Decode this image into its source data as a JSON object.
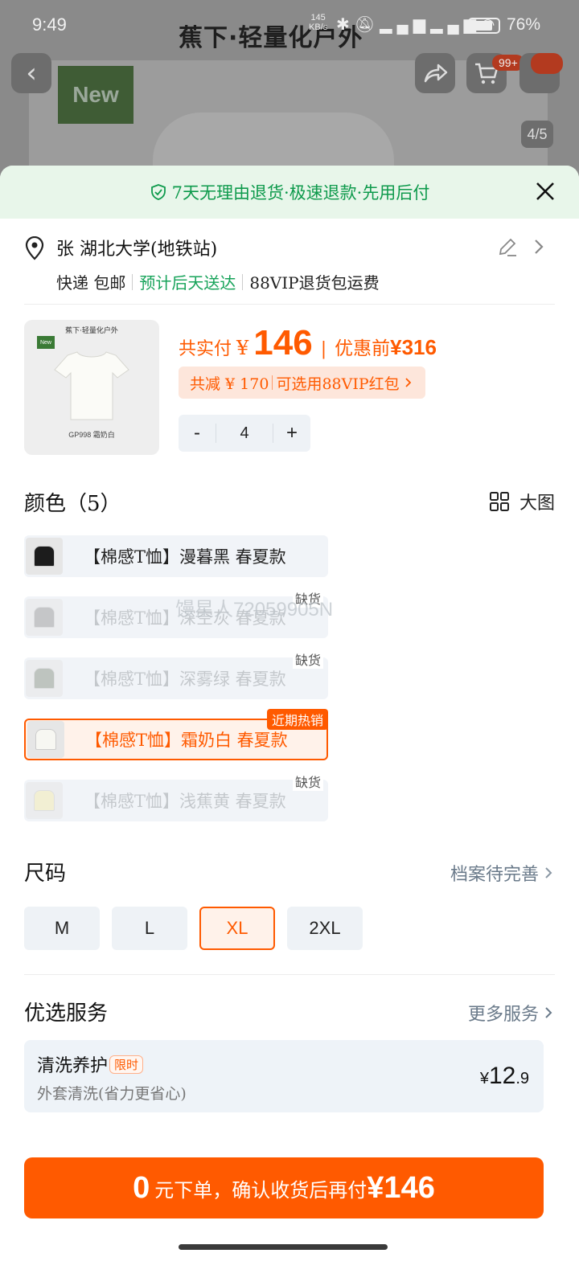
{
  "status_bar": {
    "time": "9:49",
    "speed_value": "145",
    "speed_unit": "KB/s",
    "battery": "76%"
  },
  "background": {
    "brand": "蕉下·轻量化户外",
    "new_tag": "New",
    "cart_badge": "99+",
    "image_counter": "4/5"
  },
  "banner": {
    "text": "7天无理由退货·极速退款·先用后付"
  },
  "address": {
    "line": "张 湖北大学(地铁站)",
    "shipping": "快递 包邮",
    "estimate": "预计后天送达",
    "vip_return": "88VIP退货包运费"
  },
  "product": {
    "thumb_brand": "蕉下·轻量化户外",
    "thumb_new": "New",
    "thumb_caption": "GP998 霜奶白",
    "paid_label": "共实付",
    "yen": "¥",
    "paid_amount": "146",
    "before_label": "优惠前",
    "before_amount": "¥316",
    "discount_text": "共减 ¥ 170",
    "discount_vip": "可选用88VIP红包",
    "quantity": "4",
    "minus": "-",
    "plus": "+"
  },
  "color_section": {
    "title": "颜色（5）",
    "big_image": "大图",
    "options": [
      {
        "name": "【棉感T恤】漫暮黑 春夏款",
        "swatch": "#1c1c1c",
        "state": "normal",
        "tag": ""
      },
      {
        "name": "【棉感T恤】深空灰 春夏款",
        "swatch": "#9a9a9a",
        "state": "disabled",
        "tag": "缺货"
      },
      {
        "name": "【棉感T恤】深雾绿 春夏款",
        "swatch": "#8d9688",
        "state": "disabled",
        "tag": "缺货"
      },
      {
        "name": "【棉感T恤】霜奶白 春夏款",
        "swatch": "#f7f7f2",
        "state": "selected",
        "tag": "近期热销"
      },
      {
        "name": "【棉感T恤】浅蕉黄 春夏款",
        "swatch": "#f3ecb0",
        "state": "disabled",
        "tag": "缺货"
      }
    ],
    "watermark": "馒星人72059905N"
  },
  "size_section": {
    "title": "尺码",
    "profile_link": "档案待完善",
    "sizes": [
      "M",
      "L",
      "XL",
      "2XL"
    ],
    "selected": "XL"
  },
  "service_section": {
    "title": "优选服务",
    "more_link": "更多服务",
    "item": {
      "name": "清洗养护",
      "badge": "限时",
      "desc": "外套清洗(省力更省心)",
      "currency": "¥",
      "price_int": "12",
      "price_dec": ".9"
    }
  },
  "cta": {
    "amount": "0",
    "text": "元下单，确认收货后再付",
    "price": "¥146"
  },
  "colors": {
    "accent": "#ff5a00",
    "green": "#17a35a"
  }
}
